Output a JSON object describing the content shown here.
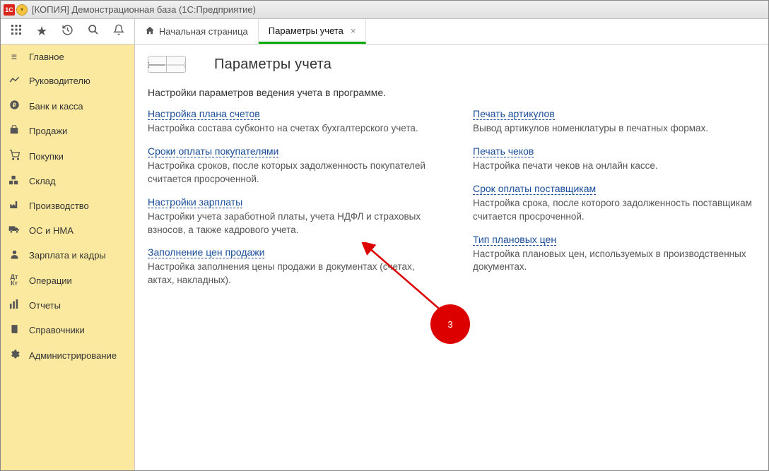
{
  "titlebar": {
    "text": "[КОПИЯ] Демонстрационная база  (1С:Предприятие)"
  },
  "tabs": {
    "home": "Начальная страница",
    "active": "Параметры учета"
  },
  "sidebar": {
    "items": [
      {
        "label": "Главное"
      },
      {
        "label": "Руководителю"
      },
      {
        "label": "Банк и касса"
      },
      {
        "label": "Продажи"
      },
      {
        "label": "Покупки"
      },
      {
        "label": "Склад"
      },
      {
        "label": "Производство"
      },
      {
        "label": "ОС и НМА"
      },
      {
        "label": "Зарплата и кадры"
      },
      {
        "label": "Операции"
      },
      {
        "label": "Отчеты"
      },
      {
        "label": "Справочники"
      },
      {
        "label": "Администрирование"
      }
    ]
  },
  "page": {
    "title": "Параметры учета",
    "description": "Настройки параметров ведения учета в программе."
  },
  "left_col": [
    {
      "link": "Настройка плана счетов",
      "desc": "Настройка состава субконто на счетах бухгалтерского учета."
    },
    {
      "link": "Сроки оплаты покупателями",
      "desc": "Настройка сроков, после которых задолженность покупателей считается просроченной."
    },
    {
      "link": "Настройки зарплаты",
      "desc": "Настройки учета заработной платы, учета НДФЛ и страховых взносов, а также кадрового учета."
    },
    {
      "link": "Заполнение цен продажи",
      "desc": "Настройка заполнения цены продажи в документах (счетах, актах, накладных)."
    }
  ],
  "right_col": [
    {
      "link": "Печать артикулов",
      "desc": "Вывод артикулов номенклатуры в печатных формах."
    },
    {
      "link": "Печать чеков",
      "desc": "Настройка печати чеков на онлайн кассе."
    },
    {
      "link": "Срок оплаты поставщикам",
      "desc": "Настройка срока, после которого задолженность поставщикам считается просроченной."
    },
    {
      "link": "Тип плановых цен",
      "desc": "Настройка плановых цен, используемых в производственных документах."
    }
  ],
  "annotation": {
    "number": "3"
  }
}
